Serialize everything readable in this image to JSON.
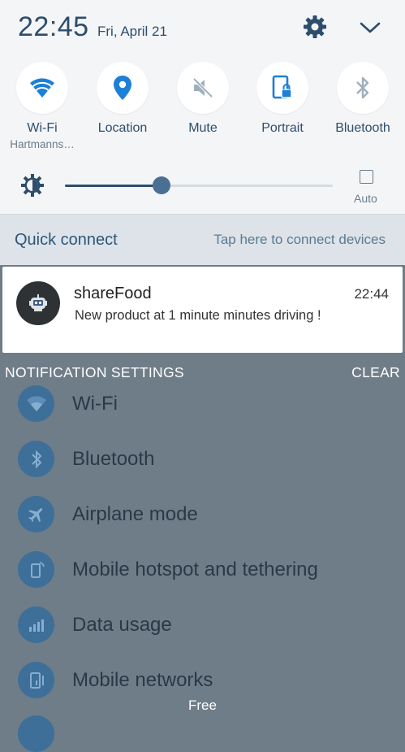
{
  "status": {
    "time": "22:45",
    "date": "Fri, April 21"
  },
  "toggles": [
    {
      "label": "Wi-Fi",
      "sub": "Hartmanns…",
      "icon": "wifi-icon",
      "active": true
    },
    {
      "label": "Location",
      "sub": "",
      "icon": "location-pin-icon",
      "active": true
    },
    {
      "label": "Mute",
      "sub": "",
      "icon": "mute-icon",
      "active": false
    },
    {
      "label": "Portrait",
      "sub": "",
      "icon": "portrait-lock-icon",
      "active": true
    },
    {
      "label": "Bluetooth",
      "sub": "",
      "icon": "bluetooth-icon",
      "active": false
    }
  ],
  "brightness": {
    "level": 0.36,
    "auto_label": "Auto",
    "auto_checked": false
  },
  "quick_connect": {
    "title": "Quick connect",
    "hint": "Tap here to connect devices"
  },
  "notification": {
    "app": "shareFood",
    "time": "22:44",
    "message": "New product at 1 minute minutes driving !"
  },
  "footer": {
    "settings_label": "NOTIFICATION SETTINGS",
    "clear_label": "CLEAR"
  },
  "background_settings": [
    {
      "label": "Wi-Fi",
      "icon": "wifi-icon"
    },
    {
      "label": "Bluetooth",
      "icon": "bluetooth-icon"
    },
    {
      "label": "Airplane mode",
      "icon": "airplane-icon"
    },
    {
      "label": "Mobile hotspot and tethering",
      "icon": "hotspot-icon"
    },
    {
      "label": "Data usage",
      "icon": "data-usage-icon"
    },
    {
      "label": "Mobile networks",
      "icon": "mobile-networks-icon"
    }
  ],
  "bottom_text": "Free",
  "colors": {
    "accent": "#2d4d6c",
    "active_icon": "#1c7fd8",
    "inactive_icon": "#9fb0bd"
  }
}
